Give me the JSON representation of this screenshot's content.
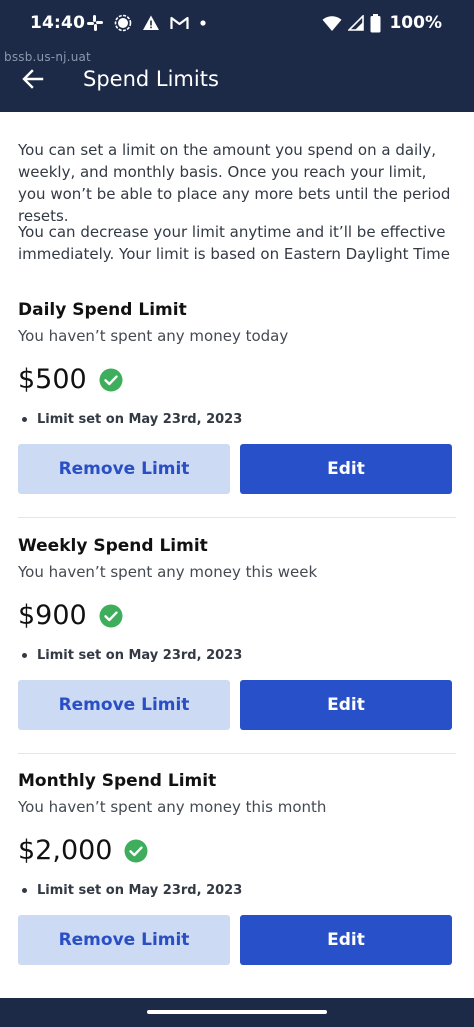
{
  "status_bar": {
    "time": "14:40",
    "battery": "100%",
    "left_icons": [
      "slack-icon",
      "signal-messenger-icon",
      "warning-icon",
      "gmail-icon",
      "dot-icon"
    ],
    "right_icons": [
      "wifi-icon",
      "cell-signal-icon",
      "battery-icon"
    ]
  },
  "app_bar": {
    "env_label": "bssb.us-nj.uat",
    "title": "Spend Limits",
    "back_icon": "arrow-left-icon"
  },
  "intro": {
    "paragraph_1": "You can set a limit on the amount you spend on a daily, weekly, and monthly basis. Once you reach your limit, you won’t be able to place any more bets until the period resets.",
    "paragraph_2": "You can decrease your limit anytime and it’ll be effective immediately. Your limit is based on Eastern Daylight Time"
  },
  "limits": [
    {
      "title": "Daily Spend Limit",
      "subtitle": "You haven’t spent any money today",
      "amount": "$500",
      "date_note": "Limit set on May 23rd, 2023",
      "remove_label": "Remove Limit",
      "edit_label": "Edit"
    },
    {
      "title": "Weekly Spend Limit",
      "subtitle": "You haven’t spent any money this week",
      "amount": "$900",
      "date_note": "Limit set on May 23rd, 2023",
      "remove_label": "Remove Limit",
      "edit_label": "Edit"
    },
    {
      "title": "Monthly Spend Limit",
      "subtitle": "You haven’t spent any money this month",
      "amount": "$2,000",
      "date_note": "Limit set on May 23rd, 2023",
      "remove_label": "Remove Limit",
      "edit_label": "Edit"
    }
  ],
  "colors": {
    "header_bg": "#1c2a47",
    "primary": "#2850c8",
    "secondary_bg": "#ccdaf3",
    "success": "#3eae5c"
  }
}
